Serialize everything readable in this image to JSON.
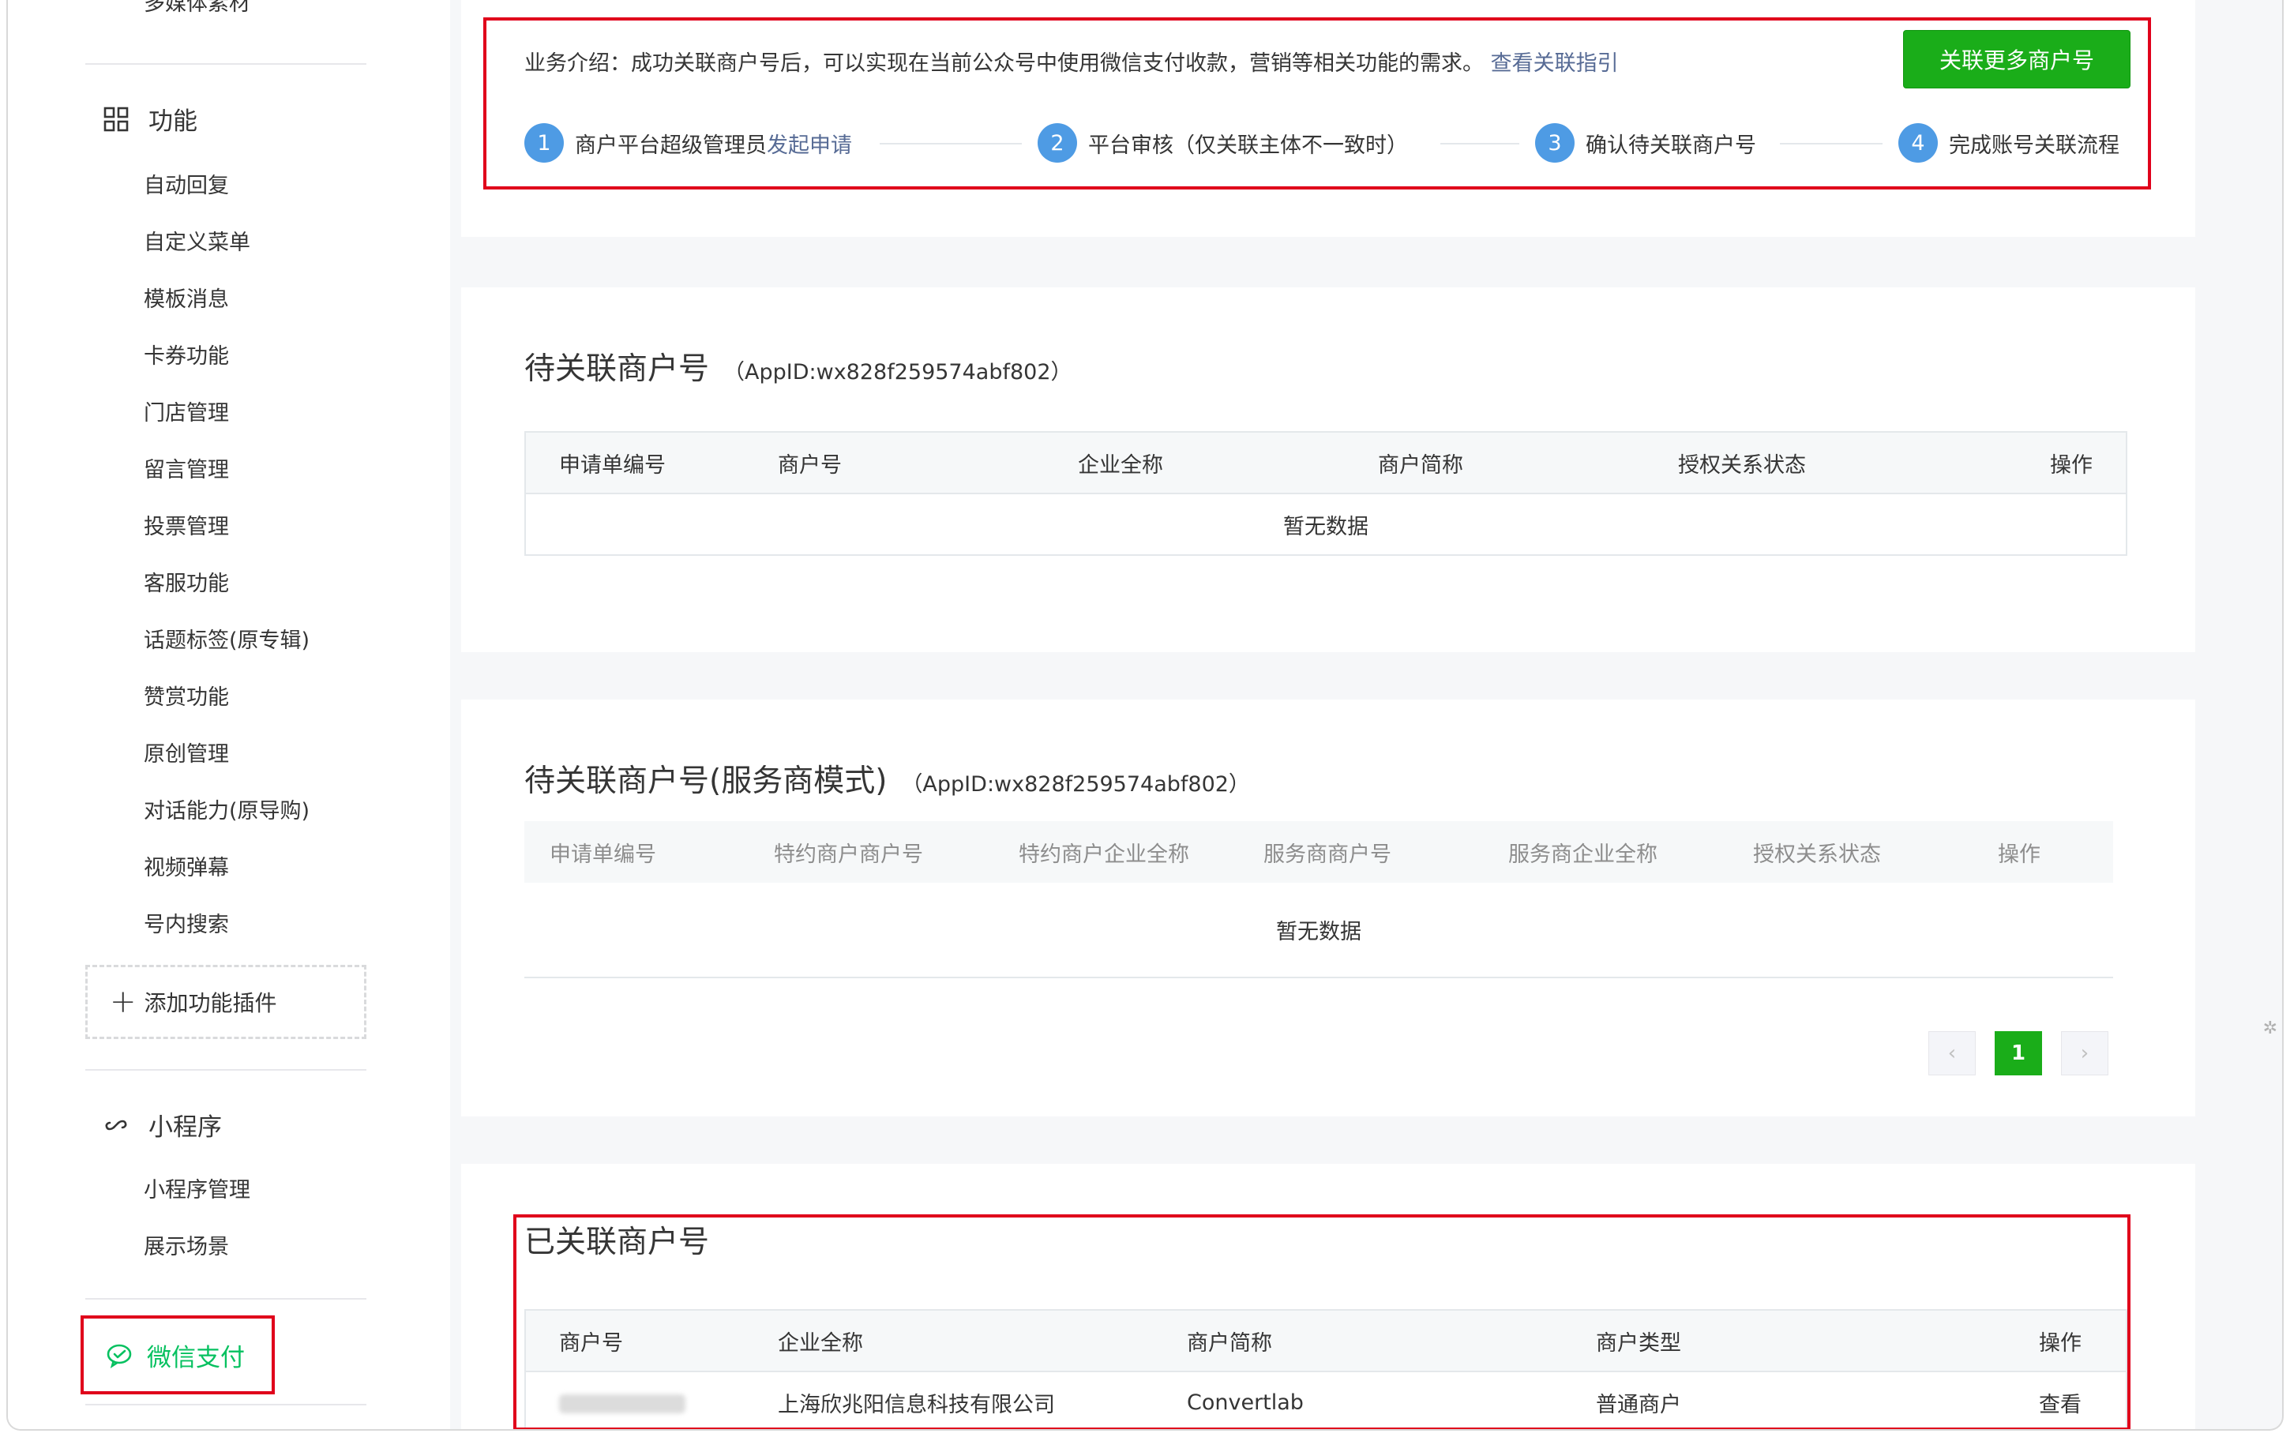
{
  "sidebar": {
    "cut_item": "多媒体素材",
    "functions": {
      "title": "功能",
      "items": [
        "自动回复",
        "自定义菜单",
        "模板消息",
        "卡券功能",
        "门店管理",
        "留言管理",
        "投票管理",
        "客服功能",
        "话题标签(原专辑)",
        "赞赏功能",
        "原创管理",
        "对话能力(原导购)",
        "视频弹幕",
        "号内搜索"
      ],
      "add_plugin": "添加功能插件"
    },
    "miniprogram": {
      "title": "小程序",
      "items": [
        "小程序管理",
        "展示场景"
      ]
    },
    "wxpay": "微信支付"
  },
  "intro": {
    "text": "业务介绍：成功关联商户号后，可以实现在当前公众号中使用微信支付收款，营销等相关功能的需求。",
    "link": "查看关联指引",
    "button": "关联更多商户号",
    "steps": [
      {
        "num": "1",
        "label": "商户平台超级管理员",
        "link": "发起申请"
      },
      {
        "num": "2",
        "label": "平台审核（仅关联主体不一致时）",
        "link": ""
      },
      {
        "num": "3",
        "label": "确认待关联商户号",
        "link": ""
      },
      {
        "num": "4",
        "label": "完成账号关联流程",
        "link": ""
      }
    ]
  },
  "pending": {
    "title": "待关联商户号",
    "appid": "（AppID:wx828f259574abf802）",
    "columns": [
      "申请单编号",
      "商户号",
      "企业全称",
      "商户简称",
      "授权关系状态",
      "操作"
    ],
    "empty": "暂无数据"
  },
  "pending_service": {
    "title": "待关联商户号(服务商模式)",
    "appid": "（AppID:wx828f259574abf802）",
    "columns": [
      "申请单编号",
      "特约商户商户号",
      "特约商户企业全称",
      "服务商商户号",
      "服务商企业全称",
      "授权关系状态",
      "操作"
    ],
    "empty": "暂无数据",
    "pager": {
      "prev": "‹",
      "current": "1",
      "next": "›"
    }
  },
  "linked": {
    "title": "已关联商户号",
    "columns": [
      "商户号",
      "企业全称",
      "商户简称",
      "商户类型",
      "操作"
    ],
    "rows": [
      {
        "company": "上海欣兆阳信息科技有限公司",
        "short": "Convertlab",
        "type": "普通商户",
        "action": "查看"
      }
    ]
  },
  "colors": {
    "accent_green": "#1aad19",
    "link_blue": "#576b95",
    "step_blue": "#4e9be4",
    "highlight_red": "#e0001b"
  }
}
